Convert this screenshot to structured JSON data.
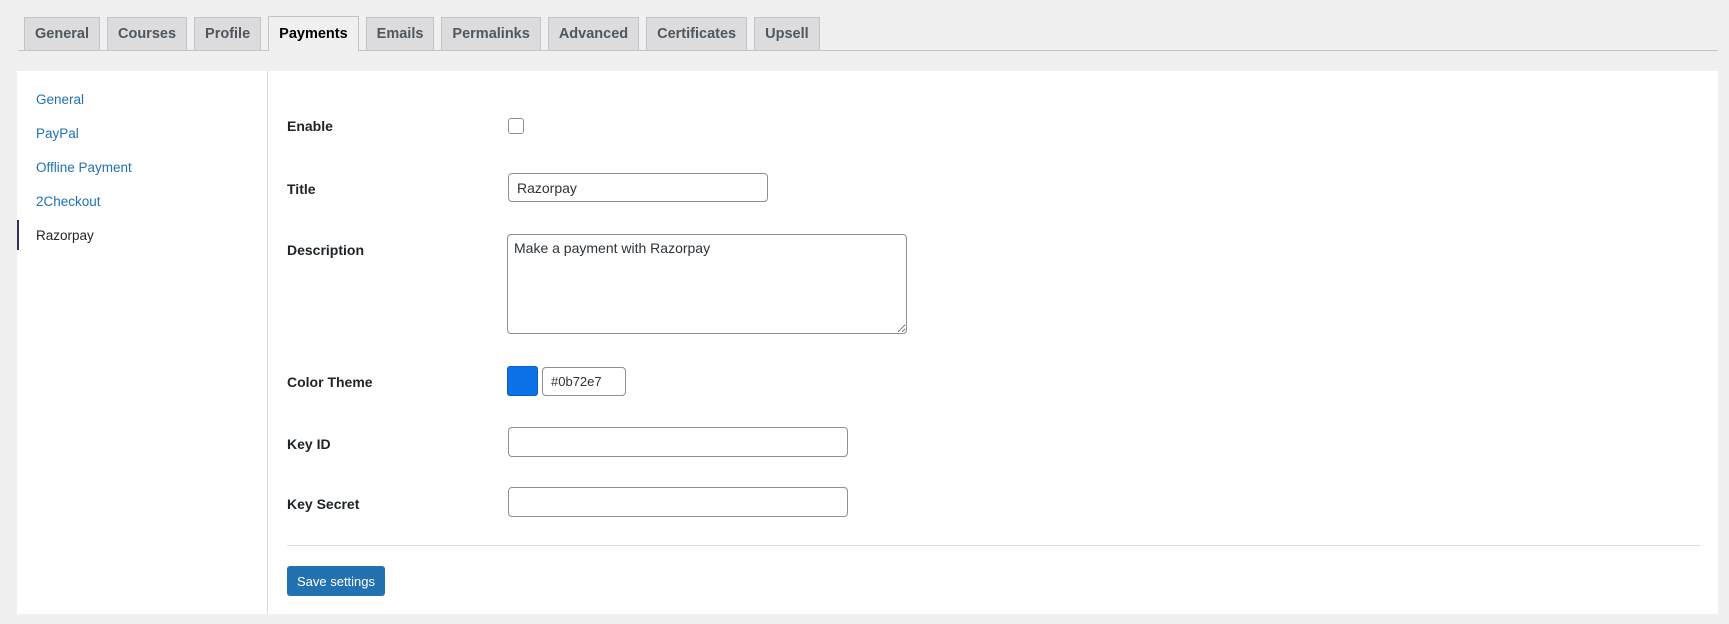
{
  "tabs": [
    {
      "label": "General"
    },
    {
      "label": "Courses"
    },
    {
      "label": "Profile"
    },
    {
      "label": "Payments",
      "active": true
    },
    {
      "label": "Emails"
    },
    {
      "label": "Permalinks"
    },
    {
      "label": "Advanced"
    },
    {
      "label": "Certificates"
    },
    {
      "label": "Upsell"
    }
  ],
  "sidebar": {
    "items": [
      {
        "label": "General"
      },
      {
        "label": "PayPal"
      },
      {
        "label": "Offline Payment"
      },
      {
        "label": "2Checkout"
      },
      {
        "label": "Razorpay",
        "active": true
      }
    ]
  },
  "form": {
    "enable_label": "Enable",
    "enable_checked": false,
    "title_label": "Title",
    "title_value": "Razorpay",
    "description_label": "Description",
    "description_value": "Make a payment with Razorpay",
    "color_theme_label": "Color Theme",
    "color_theme_value": "#0b72e7",
    "key_id_label": "Key ID",
    "key_id_value": "",
    "key_secret_label": "Key Secret",
    "key_secret_value": "",
    "save_label": "Save settings"
  },
  "colors": {
    "accent": "#2271b1",
    "swatch": "#0b72e7"
  }
}
